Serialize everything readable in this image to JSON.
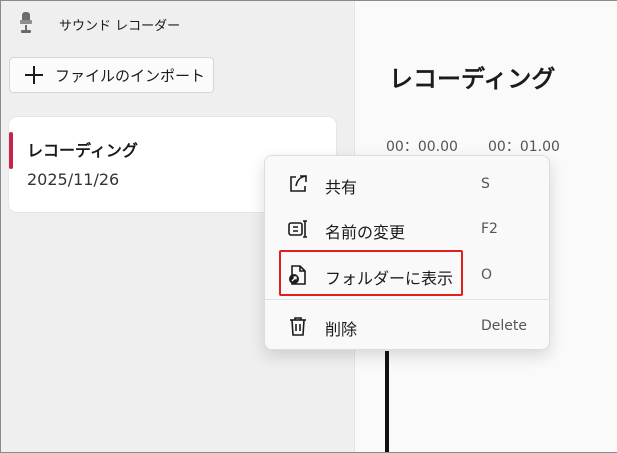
{
  "app": {
    "title": "サウンド レコーダー"
  },
  "sidebar": {
    "import_label": "ファイルのインポート",
    "recordings": [
      {
        "name": "レコーディング",
        "date": "2025/11/26"
      }
    ]
  },
  "main": {
    "heading": "レコーディング",
    "timeline": [
      "00：00.00",
      "00：01.00"
    ]
  },
  "context_menu": {
    "items": [
      {
        "label": "共有",
        "shortcut": "S",
        "icon": "share-icon"
      },
      {
        "label": "名前の変更",
        "shortcut": "F2",
        "icon": "rename-icon"
      },
      {
        "label": "フォルダーに表示",
        "shortcut": "O",
        "icon": "folder-file-icon"
      },
      {
        "label": "削除",
        "shortcut": "Delete",
        "icon": "trash-icon"
      }
    ]
  },
  "colors": {
    "accent": "#c4254a",
    "highlight_box": "#e01f1f"
  }
}
